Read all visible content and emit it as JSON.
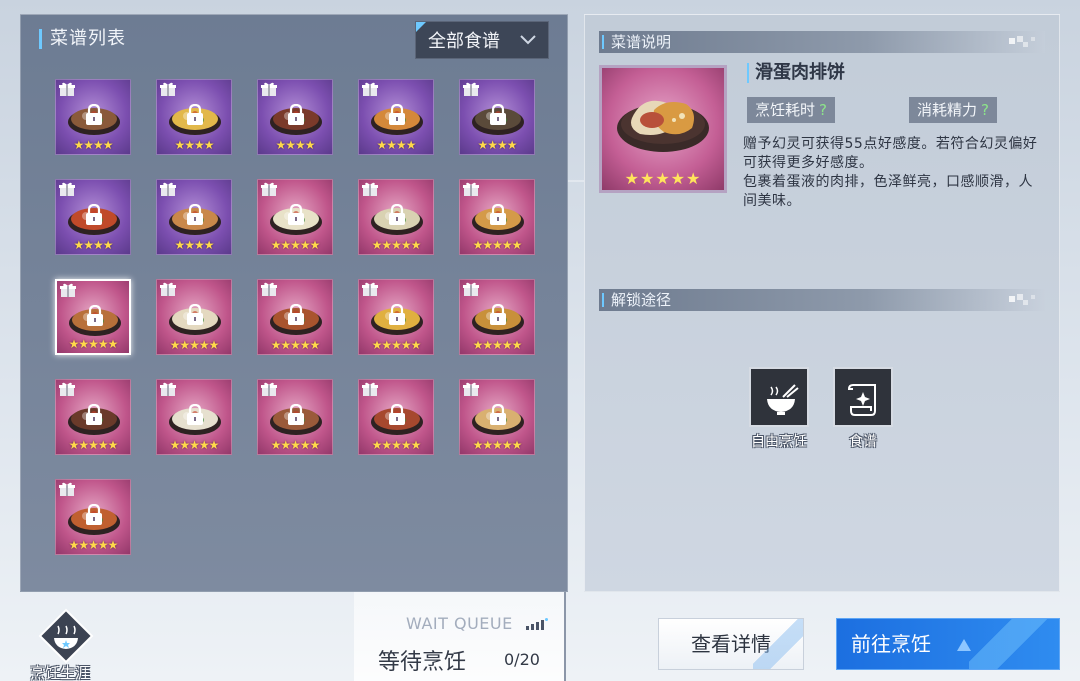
{
  "recipe_list": {
    "title": "菜谱列表",
    "filter": {
      "selected": "全部食谱"
    },
    "recipes": [
      {
        "id": 1,
        "rarity": "purple",
        "stars": "★★★★",
        "locked": true,
        "dish_color": "#8a5a3a"
      },
      {
        "id": 2,
        "rarity": "purple",
        "stars": "★★★★",
        "locked": true,
        "dish_color": "#e2b84a"
      },
      {
        "id": 3,
        "rarity": "purple",
        "stars": "★★★★",
        "locked": true,
        "dish_color": "#7a3a2a"
      },
      {
        "id": 4,
        "rarity": "purple",
        "stars": "★★★★",
        "locked": true,
        "dish_color": "#d4883a"
      },
      {
        "id": 5,
        "rarity": "purple",
        "stars": "★★★★",
        "locked": true,
        "dish_color": "#5a4a3a"
      },
      {
        "id": 6,
        "rarity": "purple",
        "stars": "★★★★",
        "locked": true,
        "dish_color": "#c04a2a"
      },
      {
        "id": 7,
        "rarity": "purple",
        "stars": "★★★★",
        "locked": true,
        "dish_color": "#c9884a"
      },
      {
        "id": 8,
        "rarity": "pink",
        "stars": "★★★★★",
        "locked": true,
        "dish_color": "#e8e2c8"
      },
      {
        "id": 9,
        "rarity": "pink",
        "stars": "★★★★★",
        "locked": true,
        "dish_color": "#d9d2b2"
      },
      {
        "id": 10,
        "rarity": "pink",
        "stars": "★★★★★",
        "locked": true,
        "dish_color": "#d49a48"
      },
      {
        "id": 11,
        "rarity": "pink",
        "stars": "★★★★★",
        "locked": true,
        "dish_color": "#b8703a",
        "selected": true
      },
      {
        "id": 12,
        "rarity": "pink",
        "stars": "★★★★★",
        "locked": true,
        "dish_color": "#e4d9c0"
      },
      {
        "id": 13,
        "rarity": "pink",
        "stars": "★★★★★",
        "locked": true,
        "dish_color": "#a9542e"
      },
      {
        "id": 14,
        "rarity": "pink",
        "stars": "★★★★★",
        "locked": true,
        "dish_color": "#e0b040"
      },
      {
        "id": 15,
        "rarity": "pink",
        "stars": "★★★★★",
        "locked": true,
        "dish_color": "#c8903a"
      },
      {
        "id": 16,
        "rarity": "pink",
        "stars": "★★★★★",
        "locked": true,
        "dish_color": "#6a3a2a"
      },
      {
        "id": 17,
        "rarity": "pink",
        "stars": "★★★★★",
        "locked": true,
        "dish_color": "#e6e0cf"
      },
      {
        "id": 18,
        "rarity": "pink",
        "stars": "★★★★★",
        "locked": true,
        "dish_color": "#9a5a3a"
      },
      {
        "id": 19,
        "rarity": "pink",
        "stars": "★★★★★",
        "locked": true,
        "dish_color": "#a6482e"
      },
      {
        "id": 20,
        "rarity": "pink",
        "stars": "★★★★★",
        "locked": true,
        "dish_color": "#d9b070"
      },
      {
        "id": 21,
        "rarity": "pink",
        "stars": "★★★★★",
        "locked": true,
        "dish_color": "#c06030"
      }
    ]
  },
  "detail": {
    "section_title": "菜谱说明",
    "dish_name": "滑蛋肉排饼",
    "portrait_stars": "★★★★★",
    "cook_time_label": "烹饪耗时",
    "energy_label": "消耗精力",
    "help_mark": "?",
    "description_1": "赠予幻灵可获得55点好感度。若符合幻灵偏好可获得更多好感度。",
    "description_2": "包裹着蛋液的肉排，色泽鲜亮，口感顺滑，人间美味。",
    "unlock_title": "解锁途径",
    "sources": [
      {
        "label": "自由烹饪",
        "icon": "bowl-chopsticks-icon"
      },
      {
        "label": "食谱",
        "icon": "recipe-scroll-icon"
      }
    ]
  },
  "bottom": {
    "career_label": "烹饪生涯",
    "queue_en": "WAIT QUEUE",
    "queue_cn": "等待烹饪",
    "queue_count": "0/20",
    "detail_button": "查看详情",
    "go_button": "前往烹饪"
  },
  "colors": {
    "accent": "#6ec9ff",
    "go_button": "#2f8cf0",
    "star": "#ffd94a",
    "purple_card": "#7c4fb0",
    "pink_card": "#c0568b"
  }
}
